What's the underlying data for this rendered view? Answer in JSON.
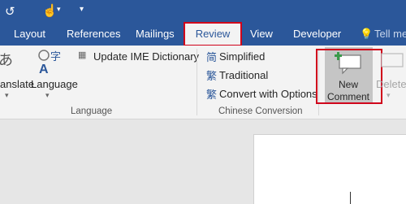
{
  "tabs": {
    "layout": "Layout",
    "references": "References",
    "mailings": "Mailings",
    "review": "Review",
    "view": "View",
    "developer": "Developer",
    "tell_me": "Tell me"
  },
  "ribbon": {
    "translate": "anslate",
    "language": "Language",
    "update_ime": "Update IME Dictionary",
    "language_group": "Language",
    "simplified": "Simplified",
    "traditional": "Traditional",
    "convert": "Convert with Options",
    "chinese_group": "Chinese Conversion",
    "new_comment_1": "New",
    "new_comment_2": "Comment",
    "delete": "Delete"
  },
  "colors": {
    "accent": "#2b579a",
    "highlight": "#d0021b"
  }
}
